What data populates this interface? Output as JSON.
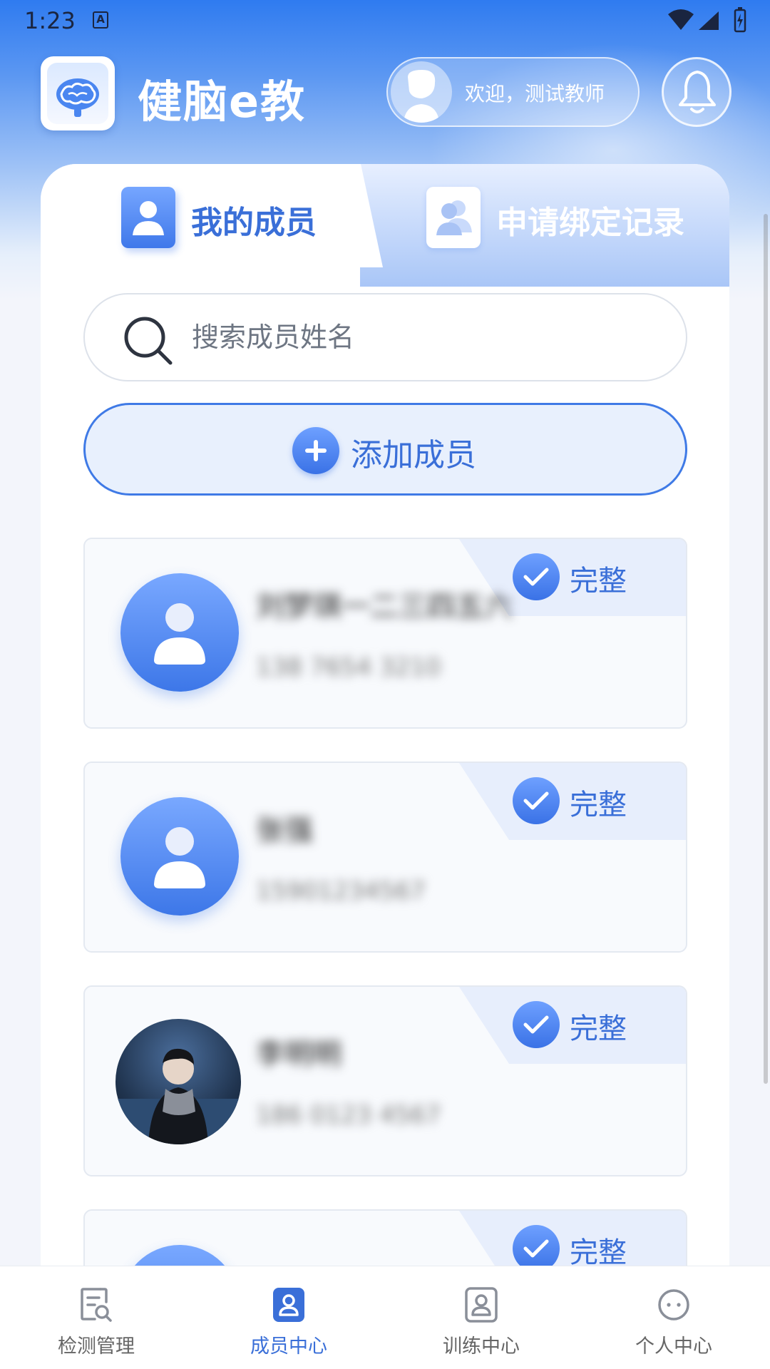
{
  "status_bar": {
    "time": "1:23",
    "notification": "A"
  },
  "header": {
    "app_title": "健脑e教",
    "welcome": "欢迎，测试教师"
  },
  "tabs": [
    {
      "label": "我的成员",
      "active": true
    },
    {
      "label": "申请绑定记录",
      "active": false
    }
  ],
  "search": {
    "placeholder": "搜索成员姓名",
    "value": ""
  },
  "add_button": {
    "label": "添加成员"
  },
  "members": [
    {
      "name": "刘梦琪一二三四五六",
      "phone": "138 7654 3210",
      "status": "完整",
      "avatar": "default"
    },
    {
      "name": "张强",
      "phone": "15901234567",
      "status": "完整",
      "avatar": "default"
    },
    {
      "name": "李明明",
      "phone": "186 0123 4567",
      "status": "完整",
      "avatar": "photo"
    },
    {
      "name": "",
      "phone": "",
      "status": "完整",
      "avatar": "default"
    }
  ],
  "bottom_nav": [
    {
      "label": "检测管理",
      "icon": "report-search-icon",
      "active": false
    },
    {
      "label": "成员中心",
      "icon": "member-badge-icon",
      "active": true
    },
    {
      "label": "训练中心",
      "icon": "training-user-icon",
      "active": false
    },
    {
      "label": "个人中心",
      "icon": "profile-face-icon",
      "active": false
    }
  ],
  "colors": {
    "accent": "#3a6fd8",
    "header_top": "#2f7bf0",
    "tag_bg": "#e7eefc"
  }
}
